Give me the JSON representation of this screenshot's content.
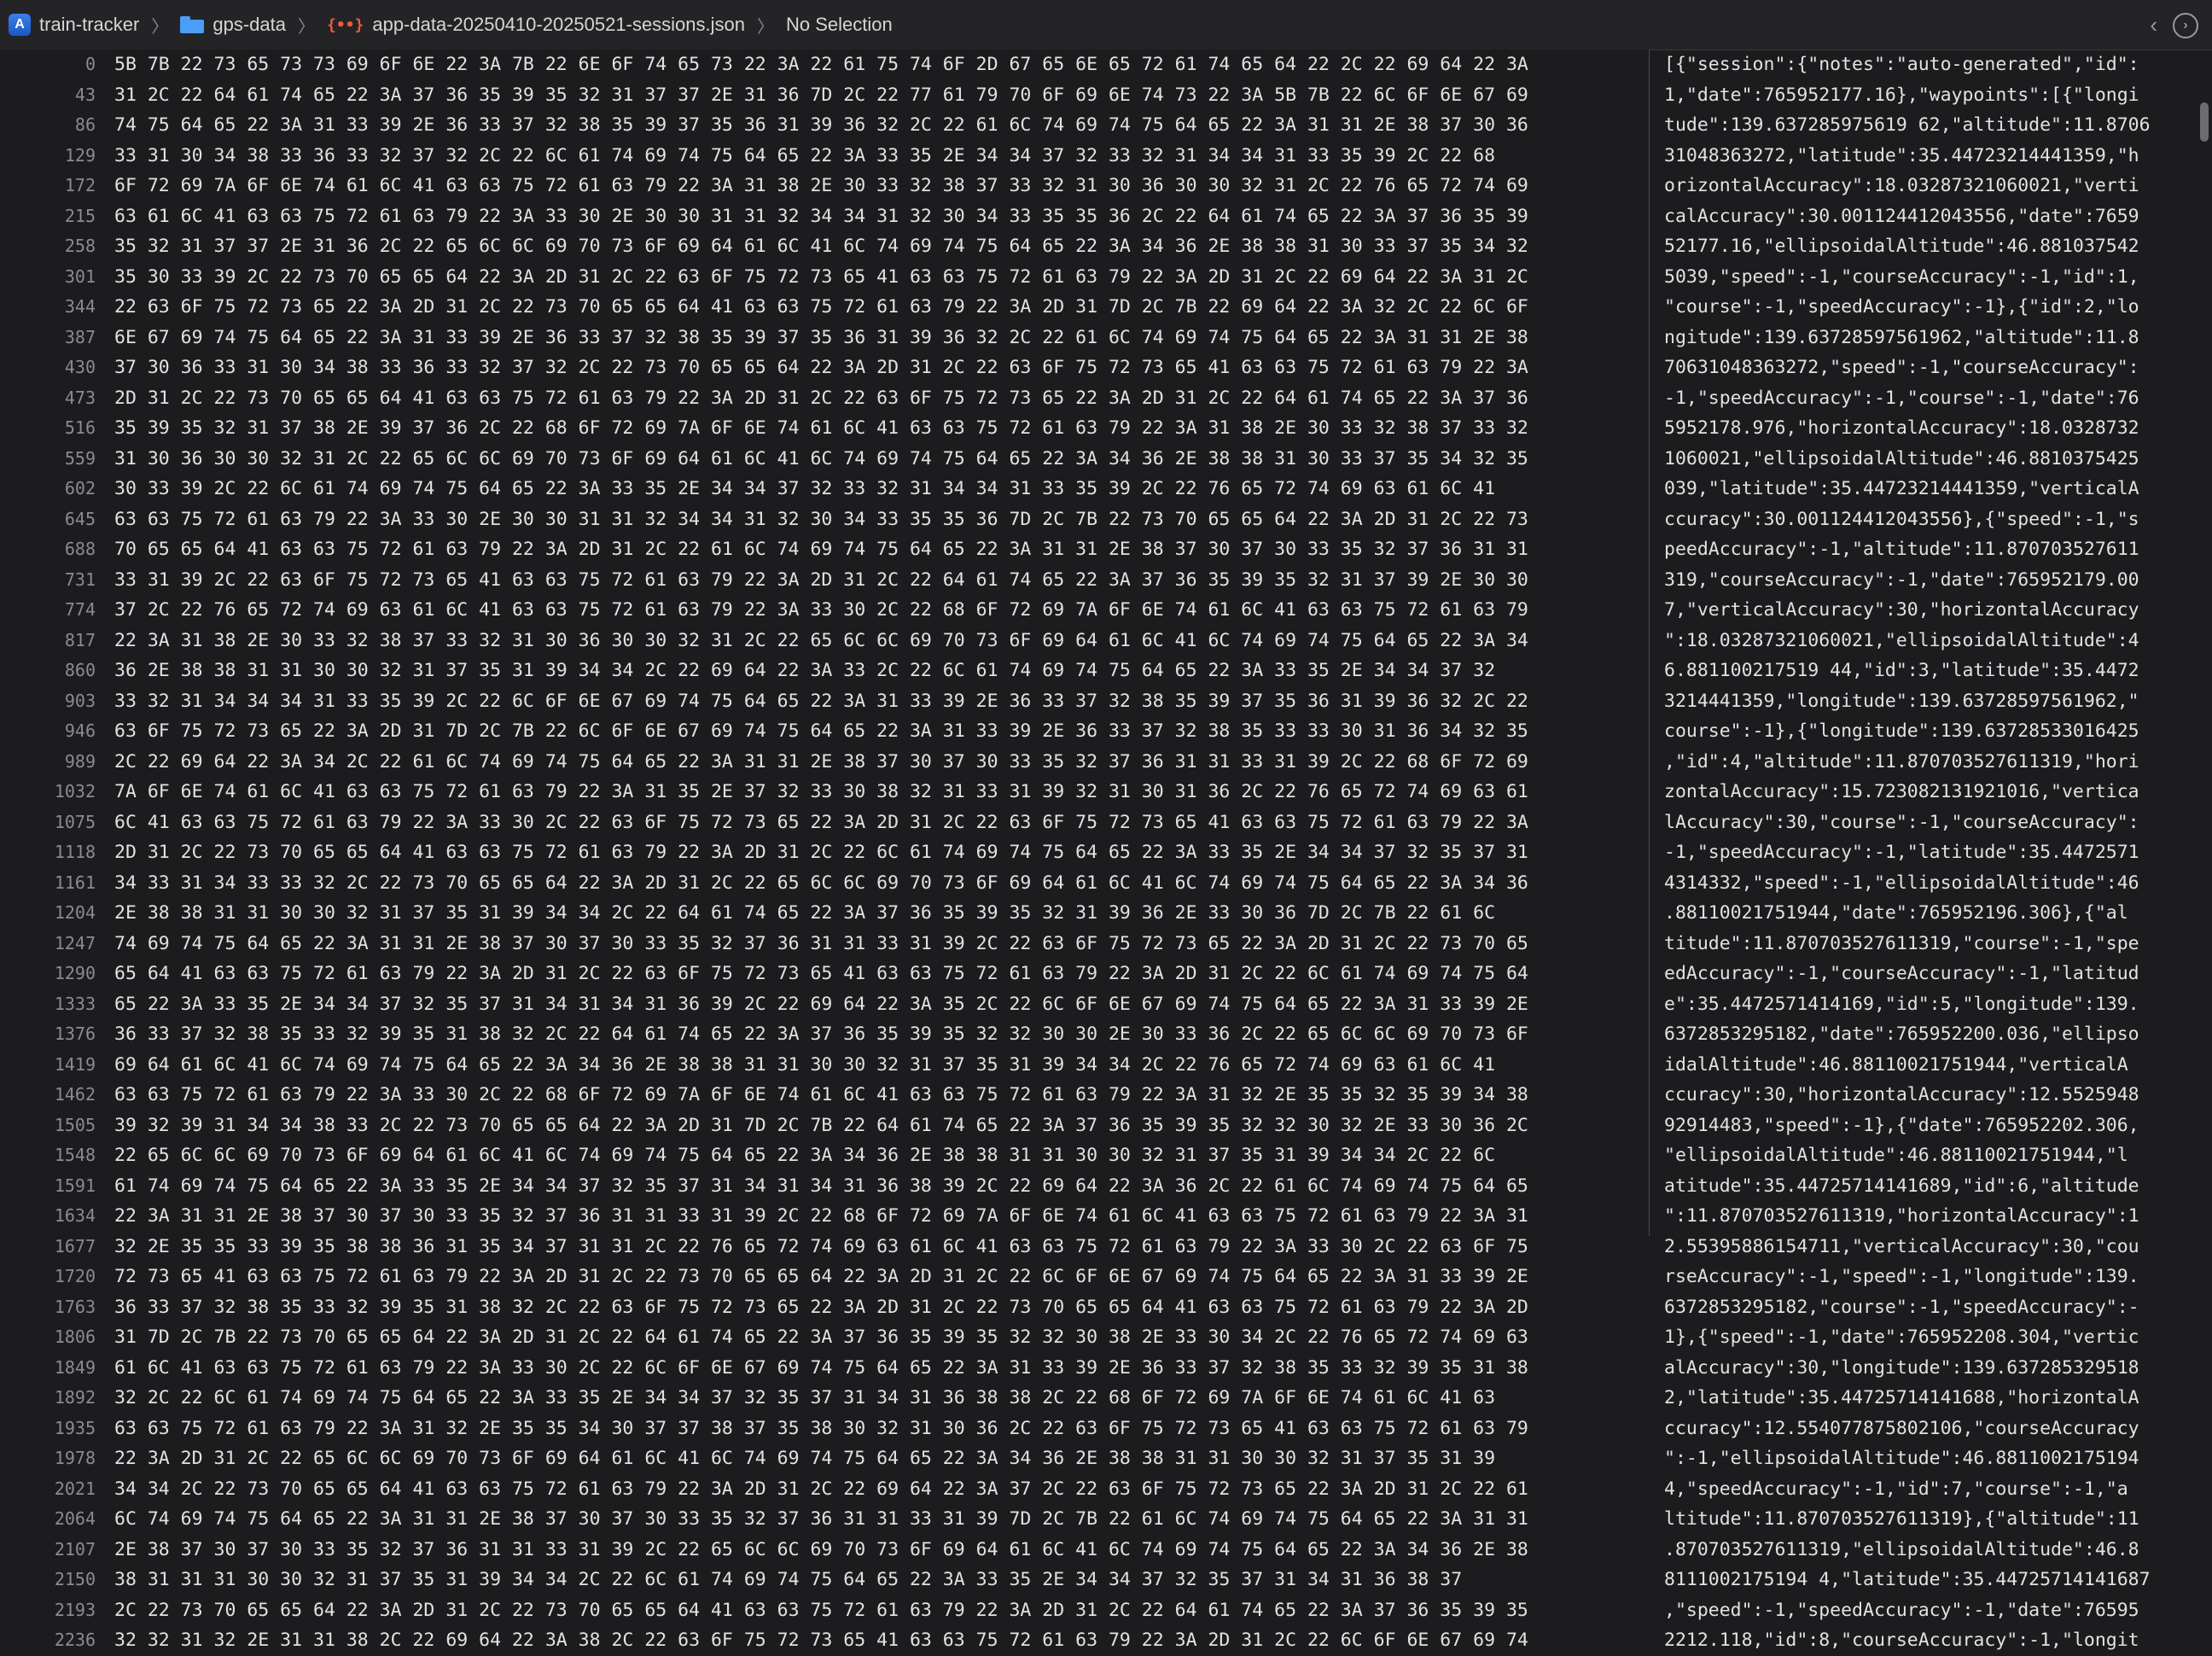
{
  "breadcrumb": {
    "project": "train-tracker",
    "folder": "gps-data",
    "file": "app-data-20250410-20250521-sessions.json",
    "selection": "No Selection",
    "file_icon_glyph": "{••}"
  },
  "hex": {
    "offsets": [
      "0",
      "43",
      "86",
      "129",
      "172",
      "215",
      "258",
      "301",
      "344",
      "387",
      "430",
      "473",
      "516",
      "559",
      "602",
      "645",
      "688",
      "731",
      "774",
      "817",
      "860",
      "903",
      "946",
      "989",
      "1032",
      "1075",
      "1118",
      "1161",
      "1204",
      "1247",
      "1290",
      "1333",
      "1376",
      "1419",
      "1462",
      "1505",
      "1548",
      "1591",
      "1634",
      "1677",
      "1720",
      "1763",
      "1806",
      "1849",
      "1892",
      "1935",
      "1978",
      "2021",
      "2064",
      "2107",
      "2150",
      "2193",
      "2236"
    ],
    "rows": [
      "5B 7B 22 73 65 73 73 69 6F 6E 22 3A 7B 22 6E 6F 74 65 73 22 3A 22 61 75 74 6F 2D 67 65 6E 65 72 61 74 65 64 22 2C 22 69 64 22 3A",
      "31 2C 22 64 61 74 65 22 3A 37 36 35 39 35 32 31 37 37 2E 31 36 7D 2C 22 77 61 79 70 6F 69 6E 74 73 22 3A 5B 7B 22 6C 6F 6E 67 69",
      "74 75 64 65 22 3A 31 33 39 2E 36 33 37 32 38 35 39 37 35 36 31 39 36 32 2C 22 61 6C 74 69 74 75 64 65 22 3A 31 31 2E 38 37 30 36",
      "33 31 30 34 38 33 36 33 32 37 32 2C 22 6C 61 74 69 74 75 64 65 22 3A 33 35 2E 34 34 37 32 33 32 31 34 34 31 33 35 39 2C 22 68",
      "6F 72 69 7A 6F 6E 74 61 6C 41 63 63 75 72 61 63 79 22 3A 31 38 2E 30 33 32 38 37 33 32 31 30 36 30 30 32 31 2C 22 76 65 72 74 69",
      "63 61 6C 41 63 63 75 72 61 63 79 22 3A 33 30 2E 30 30 31 31 32 34 34 31 32 30 34 33 35 35 36 2C 22 64 61 74 65 22 3A 37 36 35 39",
      "35 32 31 37 37 2E 31 36 2C 22 65 6C 6C 69 70 73 6F 69 64 61 6C 41 6C 74 69 74 75 64 65 22 3A 34 36 2E 38 38 31 30 33 37 35 34 32",
      "35 30 33 39 2C 22 73 70 65 65 64 22 3A 2D 31 2C 22 63 6F 75 72 73 65 41 63 63 75 72 61 63 79 22 3A 2D 31 2C 22 69 64 22 3A 31 2C",
      "22 63 6F 75 72 73 65 22 3A 2D 31 2C 22 73 70 65 65 64 41 63 63 75 72 61 63 79 22 3A 2D 31 7D 2C 7B 22 69 64 22 3A 32 2C 22 6C 6F",
      "6E 67 69 74 75 64 65 22 3A 31 33 39 2E 36 33 37 32 38 35 39 37 35 36 31 39 36 32 2C 22 61 6C 74 69 74 75 64 65 22 3A 31 31 2E 38",
      "37 30 36 33 31 30 34 38 33 36 33 32 37 32 2C 22 73 70 65 65 64 22 3A 2D 31 2C 22 63 6F 75 72 73 65 41 63 63 75 72 61 63 79 22 3A",
      "2D 31 2C 22 73 70 65 65 64 41 63 63 75 72 61 63 79 22 3A 2D 31 2C 22 63 6F 75 72 73 65 22 3A 2D 31 2C 22 64 61 74 65 22 3A 37 36",
      "35 39 35 32 31 37 38 2E 39 37 36 2C 22 68 6F 72 69 7A 6F 6E 74 61 6C 41 63 63 75 72 61 63 79 22 3A 31 38 2E 30 33 32 38 37 33 32",
      "31 30 36 30 30 32 31 2C 22 65 6C 6C 69 70 73 6F 69 64 61 6C 41 6C 74 69 74 75 64 65 22 3A 34 36 2E 38 38 31 30 33 37 35 34 32 35",
      "30 33 39 2C 22 6C 61 74 69 74 75 64 65 22 3A 33 35 2E 34 34 37 32 33 32 31 34 34 31 33 35 39 2C 22 76 65 72 74 69 63 61 6C 41",
      "63 63 75 72 61 63 79 22 3A 33 30 2E 30 30 31 31 32 34 34 31 32 30 34 33 35 35 36 7D 2C 7B 22 73 70 65 65 64 22 3A 2D 31 2C 22 73",
      "70 65 65 64 41 63 63 75 72 61 63 79 22 3A 2D 31 2C 22 61 6C 74 69 74 75 64 65 22 3A 31 31 2E 38 37 30 37 30 33 35 32 37 36 31 31",
      "33 31 39 2C 22 63 6F 75 72 73 65 41 63 63 75 72 61 63 79 22 3A 2D 31 2C 22 64 61 74 65 22 3A 37 36 35 39 35 32 31 37 39 2E 30 30",
      "37 2C 22 76 65 72 74 69 63 61 6C 41 63 63 75 72 61 63 79 22 3A 33 30 2C 22 68 6F 72 69 7A 6F 6E 74 61 6C 41 63 63 75 72 61 63 79",
      "22 3A 31 38 2E 30 33 32 38 37 33 32 31 30 36 30 30 32 31 2C 22 65 6C 6C 69 70 73 6F 69 64 61 6C 41 6C 74 69 74 75 64 65 22 3A 34",
      "36 2E 38 38 31 31 30 30 32 31 37 35 31 39 34 34 2C 22 69 64 22 3A 33 2C 22 6C 61 74 69 74 75 64 65 22 3A 33 35 2E 34 34 37 32",
      "33 32 31 34 34 34 31 33 35 39 2C 22 6C 6F 6E 67 69 74 75 64 65 22 3A 31 33 39 2E 36 33 37 32 38 35 39 37 35 36 31 39 36 32 2C 22",
      "63 6F 75 72 73 65 22 3A 2D 31 7D 2C 7B 22 6C 6F 6E 67 69 74 75 64 65 22 3A 31 33 39 2E 36 33 37 32 38 35 33 33 30 31 36 34 32 35",
      "2C 22 69 64 22 3A 34 2C 22 61 6C 74 69 74 75 64 65 22 3A 31 31 2E 38 37 30 37 30 33 35 32 37 36 31 31 33 31 39 2C 22 68 6F 72 69",
      "7A 6F 6E 74 61 6C 41 63 63 75 72 61 63 79 22 3A 31 35 2E 37 32 33 30 38 32 31 33 31 39 32 31 30 31 36 2C 22 76 65 72 74 69 63 61",
      "6C 41 63 63 75 72 61 63 79 22 3A 33 30 2C 22 63 6F 75 72 73 65 22 3A 2D 31 2C 22 63 6F 75 72 73 65 41 63 63 75 72 61 63 79 22 3A",
      "2D 31 2C 22 73 70 65 65 64 41 63 63 75 72 61 63 79 22 3A 2D 31 2C 22 6C 61 74 69 74 75 64 65 22 3A 33 35 2E 34 34 37 32 35 37 31",
      "34 33 31 34 33 33 32 2C 22 73 70 65 65 64 22 3A 2D 31 2C 22 65 6C 6C 69 70 73 6F 69 64 61 6C 41 6C 74 69 74 75 64 65 22 3A 34 36",
      "2E 38 38 31 31 30 30 32 31 37 35 31 39 34 34 2C 22 64 61 74 65 22 3A 37 36 35 39 35 32 31 39 36 2E 33 30 36 7D 2C 7B 22 61 6C",
      "74 69 74 75 64 65 22 3A 31 31 2E 38 37 30 37 30 33 35 32 37 36 31 31 33 31 39 2C 22 63 6F 75 72 73 65 22 3A 2D 31 2C 22 73 70 65",
      "65 64 41 63 63 75 72 61 63 79 22 3A 2D 31 2C 22 63 6F 75 72 73 65 41 63 63 75 72 61 63 79 22 3A 2D 31 2C 22 6C 61 74 69 74 75 64",
      "65 22 3A 33 35 2E 34 34 37 32 35 37 31 34 31 34 31 36 39 2C 22 69 64 22 3A 35 2C 22 6C 6F 6E 67 69 74 75 64 65 22 3A 31 33 39 2E",
      "36 33 37 32 38 35 33 32 39 35 31 38 32 2C 22 64 61 74 65 22 3A 37 36 35 39 35 32 32 30 30 2E 30 33 36 2C 22 65 6C 6C 69 70 73 6F",
      "69 64 61 6C 41 6C 74 69 74 75 64 65 22 3A 34 36 2E 38 38 31 31 30 30 32 31 37 35 31 39 34 34 2C 22 76 65 72 74 69 63 61 6C 41",
      "63 63 75 72 61 63 79 22 3A 33 30 2C 22 68 6F 72 69 7A 6F 6E 74 61 6C 41 63 63 75 72 61 63 79 22 3A 31 32 2E 35 35 32 35 39 34 38",
      "39 32 39 31 34 34 38 33 2C 22 73 70 65 65 64 22 3A 2D 31 7D 2C 7B 22 64 61 74 65 22 3A 37 36 35 39 35 32 32 30 32 2E 33 30 36 2C",
      "22 65 6C 6C 69 70 73 6F 69 64 61 6C 41 6C 74 69 74 75 64 65 22 3A 34 36 2E 38 38 31 31 30 30 32 31 37 35 31 39 34 34 2C 22 6C",
      "61 74 69 74 75 64 65 22 3A 33 35 2E 34 34 37 32 35 37 31 34 31 34 31 36 38 39 2C 22 69 64 22 3A 36 2C 22 61 6C 74 69 74 75 64 65",
      "22 3A 31 31 2E 38 37 30 37 30 33 35 32 37 36 31 31 33 31 39 2C 22 68 6F 72 69 7A 6F 6E 74 61 6C 41 63 63 75 72 61 63 79 22 3A 31",
      "32 2E 35 35 33 39 35 38 38 36 31 35 34 37 31 31 2C 22 76 65 72 74 69 63 61 6C 41 63 63 75 72 61 63 79 22 3A 33 30 2C 22 63 6F 75",
      "72 73 65 41 63 63 75 72 61 63 79 22 3A 2D 31 2C 22 73 70 65 65 64 22 3A 2D 31 2C 22 6C 6F 6E 67 69 74 75 64 65 22 3A 31 33 39 2E",
      "36 33 37 32 38 35 33 32 39 35 31 38 32 2C 22 63 6F 75 72 73 65 22 3A 2D 31 2C 22 73 70 65 65 64 41 63 63 75 72 61 63 79 22 3A 2D",
      "31 7D 2C 7B 22 73 70 65 65 64 22 3A 2D 31 2C 22 64 61 74 65 22 3A 37 36 35 39 35 32 32 30 38 2E 33 30 34 2C 22 76 65 72 74 69 63",
      "61 6C 41 63 63 75 72 61 63 79 22 3A 33 30 2C 22 6C 6F 6E 67 69 74 75 64 65 22 3A 31 33 39 2E 36 33 37 32 38 35 33 32 39 35 31 38",
      "32 2C 22 6C 61 74 69 74 75 64 65 22 3A 33 35 2E 34 34 37 32 35 37 31 34 31 36 38 38 2C 22 68 6F 72 69 7A 6F 6E 74 61 6C 41 63",
      "63 63 75 72 61 63 79 22 3A 31 32 2E 35 35 34 30 37 37 38 37 35 38 30 32 31 30 36 2C 22 63 6F 75 72 73 65 41 63 63 75 72 61 63 79",
      "22 3A 2D 31 2C 22 65 6C 6C 69 70 73 6F 69 64 61 6C 41 6C 74 69 74 75 64 65 22 3A 34 36 2E 38 38 31 31 30 30 32 31 37 35 31 39",
      "34 34 2C 22 73 70 65 65 64 41 63 63 75 72 61 63 79 22 3A 2D 31 2C 22 69 64 22 3A 37 2C 22 63 6F 75 72 73 65 22 3A 2D 31 2C 22 61",
      "6C 74 69 74 75 64 65 22 3A 31 31 2E 38 37 30 37 30 33 35 32 37 36 31 31 33 31 39 7D 2C 7B 22 61 6C 74 69 74 75 64 65 22 3A 31 31",
      "2E 38 37 30 37 30 33 35 32 37 36 31 31 33 31 39 2C 22 65 6C 6C 69 70 73 6F 69 64 61 6C 41 6C 74 69 74 75 64 65 22 3A 34 36 2E 38",
      "38 31 31 31 30 30 32 31 37 35 31 39 34 34 2C 22 6C 61 74 69 74 75 64 65 22 3A 33 35 2E 34 34 37 32 35 37 31 34 31 36 38 37",
      "2C 22 73 70 65 65 64 22 3A 2D 31 2C 22 73 70 65 65 64 41 63 63 75 72 61 63 79 22 3A 2D 31 2C 22 64 61 74 65 22 3A 37 36 35 39 35",
      "32 32 31 32 2E 31 31 38 2C 22 69 64 22 3A 38 2C 22 63 6F 75 72 73 65 41 63 63 75 72 61 63 79 22 3A 2D 31 2C 22 6C 6F 6E 67 69 74"
    ],
    "ascii": [
      "[{\"session\":{\"notes\":\"auto-generated\",\"id\":",
      "1,\"date\":765952177.16},\"waypoints\":[{\"longi",
      "tude\":139.637285975619 62,\"altitude\":11.8706",
      "31048363272,\"latitude\":35.44723214441359,\"h",
      "orizontalAccuracy\":18.03287321060021,\"verti",
      "calAccuracy\":30.001124412043556,\"date\":7659",
      "52177.16,\"ellipsoidalAltitude\":46.881037542",
      "5039,\"speed\":-1,\"courseAccuracy\":-1,\"id\":1,",
      "\"course\":-1,\"speedAccuracy\":-1},{\"id\":2,\"lo",
      "ngitude\":139.63728597561962,\"altitude\":11.8",
      "70631048363272,\"speed\":-1,\"courseAccuracy\":",
      "-1,\"speedAccuracy\":-1,\"course\":-1,\"date\":76",
      "5952178.976,\"horizontalAccuracy\":18.0328732",
      "1060021,\"ellipsoidalAltitude\":46.8810375425",
      "039,\"latitude\":35.44723214441359,\"verticalA",
      "ccuracy\":30.001124412043556},{\"speed\":-1,\"s",
      "peedAccuracy\":-1,\"altitude\":11.870703527611",
      "319,\"courseAccuracy\":-1,\"date\":765952179.00",
      "7,\"verticalAccuracy\":30,\"horizontalAccuracy",
      "\":18.03287321060021,\"ellipsoidalAltitude\":4",
      "6.881100217519 44,\"id\":3,\"latitude\":35.4472",
      "3214441359,\"longitude\":139.63728597561962,\"",
      "course\":-1},{\"longitude\":139.63728533016425",
      ",\"id\":4,\"altitude\":11.870703527611319,\"hori",
      "zontalAccuracy\":15.723082131921016,\"vertica",
      "lAccuracy\":30,\"course\":-1,\"courseAccuracy\":",
      "-1,\"speedAccuracy\":-1,\"latitude\":35.4472571",
      "4314332,\"speed\":-1,\"ellipsoidalAltitude\":46",
      ".88110021751944,\"date\":765952196.306},{\"al",
      "titude\":11.870703527611319,\"course\":-1,\"spe",
      "edAccuracy\":-1,\"courseAccuracy\":-1,\"latitud",
      "e\":35.4472571414169,\"id\":5,\"longitude\":139.",
      "6372853295182,\"date\":765952200.036,\"ellipso",
      "idalAltitude\":46.88110021751944,\"verticalA",
      "ccuracy\":30,\"horizontalAccuracy\":12.5525948",
      "92914483,\"speed\":-1},{\"date\":765952202.306,",
      "\"ellipsoidalAltitude\":46.88110021751944,\"l",
      "atitude\":35.44725714141689,\"id\":6,\"altitude",
      "\":11.870703527611319,\"horizontalAccuracy\":1",
      "2.55395886154711,\"verticalAccuracy\":30,\"cou",
      "rseAccuracy\":-1,\"speed\":-1,\"longitude\":139.",
      "6372853295182,\"course\":-1,\"speedAccuracy\":-",
      "1},{\"speed\":-1,\"date\":765952208.304,\"vertic",
      "alAccuracy\":30,\"longitude\":139.637285329518",
      "2,\"latitude\":35.44725714141688,\"horizontalA",
      "ccuracy\":12.554077875802106,\"courseAccuracy",
      "\":-1,\"ellipsoidalAltitude\":46.8811002175194",
      "4,\"speedAccuracy\":-1,\"id\":7,\"course\":-1,\"a",
      "ltitude\":11.870703527611319},{\"altitude\":11",
      ".870703527611319,\"ellipsoidalAltitude\":46.8",
      "8111002175194 4,\"latitude\":35.44725714141687",
      ",\"speed\":-1,\"speedAccuracy\":-1,\"date\":76595",
      "2212.118,\"id\":8,\"courseAccuracy\":-1,\"longit"
    ]
  }
}
